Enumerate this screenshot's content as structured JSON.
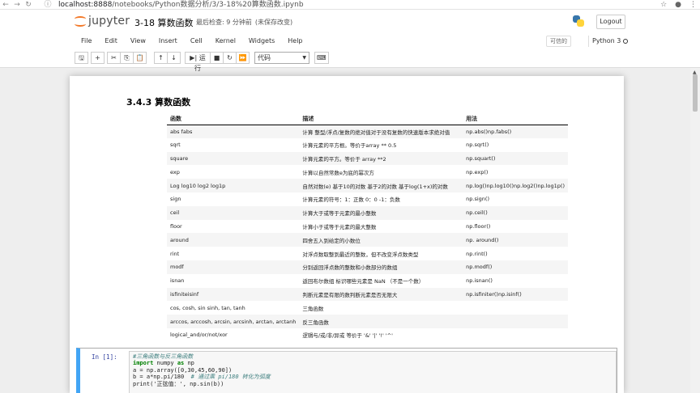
{
  "browser": {
    "url_host": "localhost:8888",
    "url_path": "/notebooks/Python数据分析/3/3-18%20算数函数.ipynb",
    "back_icon": "←",
    "forward_icon": "→",
    "reload_icon": "↻",
    "info_icon": "ⓘ",
    "star_icon": "☆",
    "account_icon": "●",
    "menu_icon": "⋮"
  },
  "header": {
    "logo_text": "jupyter",
    "notebook_title": "3-18 算数函数",
    "checkpoint_label": "最后检查: 9 分钟前",
    "unsaved_label": "(未保存改变)",
    "logout_label": "Logout"
  },
  "menu": {
    "items": [
      "File",
      "Edit",
      "View",
      "Insert",
      "Cell",
      "Kernel",
      "Widgets",
      "Help"
    ],
    "trusted_label": "可信的",
    "kernel_name": "Python 3"
  },
  "toolbar": {
    "save_icon": "🖫",
    "add_icon": "+",
    "cut_icon": "✂",
    "copy_icon": "⎘",
    "paste_icon": "📋",
    "up_icon": "↑",
    "down_icon": "↓",
    "run_label": "▶| 运行",
    "stop_icon": "■",
    "restart_icon": "↻",
    "restart_run_icon": "⏩",
    "cell_type": "代码",
    "keyboard_icon": "⌨"
  },
  "content": {
    "heading": "3.4.3 算数函数",
    "table_headers": [
      "函数",
      "描述",
      "用法"
    ],
    "rows": [
      [
        "abs fabs",
        "计算 整型/浮点/复数的绝对值对于没有复数的快速版本求绝对值",
        "np.abs()np.fabs()"
      ],
      [
        "sqrt",
        "计算元素的平方根。等价于array ** 0.5",
        "np.sqrt()"
      ],
      [
        "square",
        "计算元素的平方。等价于 array **2",
        "np.squart()"
      ],
      [
        "exp",
        "计算以自然常数e为底的幂次方",
        "np.exp()"
      ],
      [
        "Log log10 log2 log1p",
        "自然对数(e) 基于10的对数 基于2的对数 基于log(1+x)的对数",
        "np.log()np.log10()np.log2()np.log1p()"
      ],
      [
        "sign",
        "计算元素的符号：1：正数 0：0 -1：负数",
        "np.sign()"
      ],
      [
        "ceil",
        "计算大于或等于元素的最小整数",
        "np.ceil()"
      ],
      [
        "floor",
        "计算小于或等于元素的最大整数",
        "np.floor()"
      ],
      [
        "around",
        "四舍五入到给定的小数位",
        "np. around()"
      ],
      [
        "rint",
        "对浮点数取整到最近的整数，但不改变浮点数类型",
        "np.rint()"
      ],
      [
        "modf",
        "分别返回浮点数的整数和小数部分的数组",
        "np.modf()"
      ],
      [
        "isnan",
        "返回布尔数组 标识哪些元素是 NaN （不是一个数）",
        "np.isnan()"
      ],
      [
        "isfiniteisinf",
        "判断元素是有限的数判断元素是否无限大",
        "np.isfiniter()np.isinf()"
      ],
      [
        "cos, cosh, sin sinh, tan, tanh",
        "三角函数",
        ""
      ],
      [
        "arccos, arccosh, arcsin, arcsinh, arctan, arctanh",
        "反三角函数",
        ""
      ],
      [
        "logical_and/or/not/xor",
        "逻辑与/或/非/异或 等价于 '&' '|' '!' '^'",
        ""
      ]
    ]
  },
  "code_cell": {
    "prompt": "In  [1]:",
    "line1": "#三角函数与反三角函数",
    "line2_kw": "import",
    "line2_rest": " numpy ",
    "line2_as": "as",
    "line2_end": " np",
    "line3": "a = np.array([0,30,45,60,90])",
    "line4_code": "b = a*np.pi/180  ",
    "line4_comment": "# 通过乘 pi/180 转化为弧度",
    "line5": "print('正弦值：', np.sin(b))"
  }
}
